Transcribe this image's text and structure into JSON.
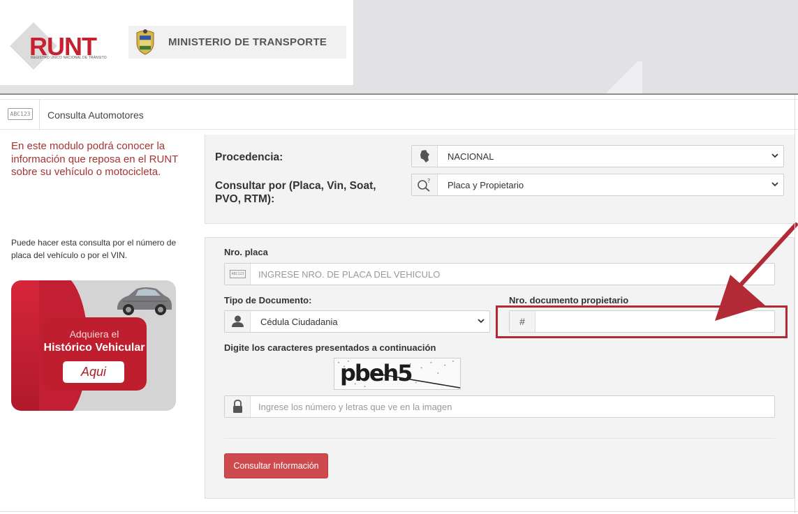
{
  "header": {
    "runt_logo_text": "RUNT",
    "runt_logo_subtitle": "REGISTRO ÚNICO NACIONAL DE TRÁNSITO",
    "ministry_name": "MINISTERIO DE TRANSPORTE"
  },
  "titlebar": {
    "icon_text": "ABC123",
    "title": "Consulta Automotores"
  },
  "sidebar": {
    "intro": "En este modulo podrá conocer la información que reposa en el RUNT sobre su vehículo o motocicleta.",
    "hint": "Puede hacer esta consulta por el número de placa del vehículo o por el VIN.",
    "promo": {
      "line1": "Adquiera el",
      "line2": "Histórico Vehicular",
      "button": "Aqui"
    }
  },
  "filters": {
    "procedencia_label": "Procedencia:",
    "procedencia_value": "NACIONAL",
    "consultar_label": "Consultar por (Placa, Vin, Soat, PVO, RTM):",
    "consultar_value": "Placa y Propietario"
  },
  "form": {
    "placa_label": "Nro. placa",
    "placa_icon_text": "ABC123",
    "placa_placeholder": "INGRESE NRO. DE PLACA DEL VEHICULO",
    "tipo_doc_label": "Tipo de Documento:",
    "tipo_doc_value": "Cédula Ciudadania",
    "nro_doc_label": "Nro. documento propietario",
    "nro_doc_icon": "#",
    "nro_doc_value": "",
    "captcha_label": "Digite los caracteres presentados a continuación",
    "captcha_text": "pbeh5",
    "captcha_placeholder": "Ingrese los número y letras que ve en la imagen",
    "submit_label": "Consultar Información"
  },
  "colors": {
    "brand_red": "#c8202e",
    "button_red": "#cf4a4e",
    "intro_text": "#a83232",
    "highlight": "#b22a36"
  },
  "icons": {
    "procedencia": "colombia-map-icon",
    "consultar": "search-question-icon",
    "tipo_doc": "user-icon",
    "captcha": "lock-icon",
    "dropdown": "chevron-down-icon"
  }
}
